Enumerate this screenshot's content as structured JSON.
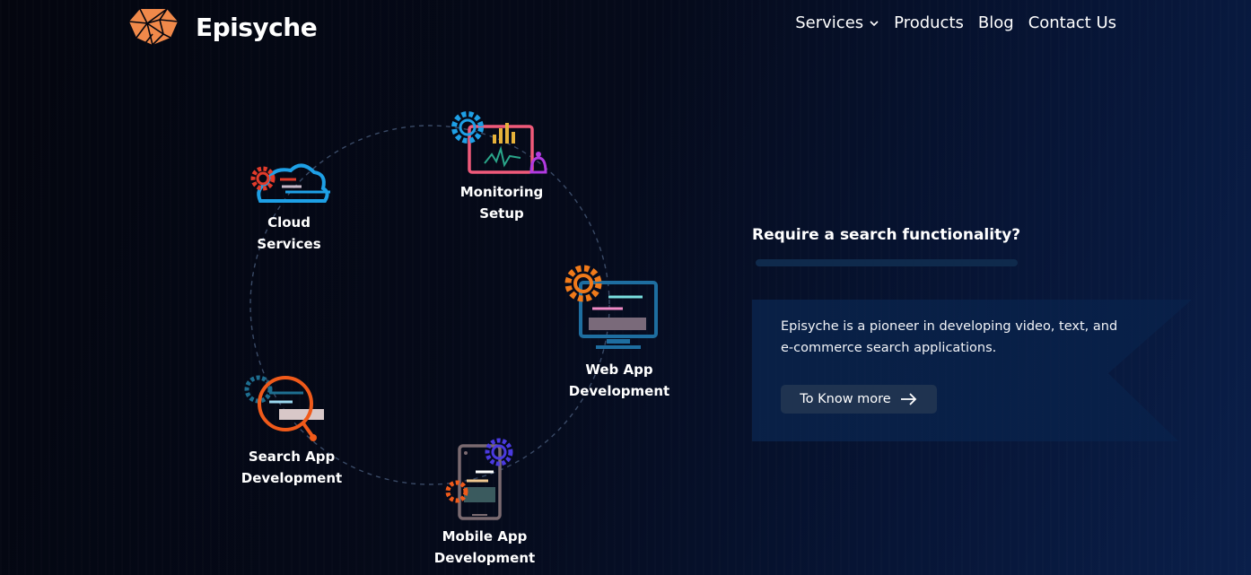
{
  "brand": {
    "name": "Episyche",
    "logo_icon": "faceted-shield-logo-icon",
    "color": "#f0894a"
  },
  "nav": {
    "items": [
      {
        "label": "Services",
        "has_dropdown": true
      },
      {
        "label": "Products"
      },
      {
        "label": "Blog"
      },
      {
        "label": "Contact Us"
      }
    ]
  },
  "services": {
    "cloud": {
      "line1": "Cloud",
      "line2": "Services",
      "icon": "cloud-gear-icon"
    },
    "monitoring": {
      "line1": "Monitoring",
      "line2": "Setup",
      "icon": "monitoring-dashboard-icon"
    },
    "web": {
      "line1": "Web App",
      "line2": "Development",
      "icon": "web-monitor-gear-icon"
    },
    "search": {
      "line1": "Search App",
      "line2": "Development",
      "icon": "search-magnifier-icon"
    },
    "mobile": {
      "line1": "Mobile App",
      "line2": "Development",
      "icon": "mobile-phone-gear-icon"
    }
  },
  "hero": {
    "headline": "Require a search functionality?",
    "description": "Episyche is a pioneer in developing video, text, and e-commerce search applications.",
    "cta_label": "To Know more",
    "cta_icon": "arrow-right-icon"
  },
  "colors": {
    "accent_orange": "#f07a1a",
    "accent_blue": "#1ea0e6",
    "panel": "#0a2650",
    "button": "#1f3350"
  }
}
